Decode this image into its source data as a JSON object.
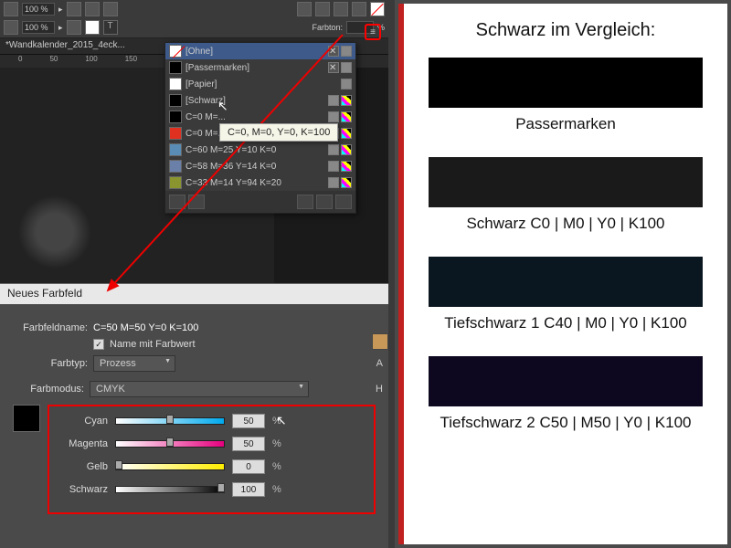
{
  "toolbar": {
    "pct1": "100 %",
    "pct2": "100 %",
    "farbton_label": "Farbton:",
    "farbton_unit": "%"
  },
  "document": {
    "tab": "*Wandkalender_2015_4eck...",
    "ruler_marks": [
      "0",
      "50",
      "100",
      "150"
    ]
  },
  "swatches": {
    "items": [
      {
        "name": "[Ohne]",
        "color": "transparent",
        "selected": true,
        "deletable": true
      },
      {
        "name": "[Passermarken]",
        "color": "#000",
        "deletable": true
      },
      {
        "name": "[Papier]",
        "color": "#fff"
      },
      {
        "name": "[Schwarz]",
        "color": "#000"
      },
      {
        "name": "C=0 M=...",
        "color": "#000"
      },
      {
        "name": "C=0 M=...",
        "color": "#e03020"
      },
      {
        "name": "C=60 M=25 Y=10 K=0",
        "color": "#5a8db5"
      },
      {
        "name": "C=58 M=36 Y=14 K=0",
        "color": "#6a80a8"
      },
      {
        "name": "C=33 M=14 Y=94 K=20",
        "color": "#8a9530"
      }
    ],
    "tooltip": "C=0, M=0, Y=0, K=100"
  },
  "dialog": {
    "title": "Neues Farbfeld",
    "name_label": "Farbfeldname:",
    "name_value": "C=50 M=50 Y=0 K=100",
    "name_with_value_label": "Name mit Farbwert",
    "farbtyp_label": "Farbtyp:",
    "farbtyp_value": "Prozess",
    "farbmodus_label": "Farbmodus:",
    "farbmodus_value": "CMYK",
    "buttons": {
      "a": "A",
      "h": "H"
    },
    "sliders": [
      {
        "label": "Cyan",
        "value": "50",
        "grad": "linear-gradient(90deg,#fff,#00aaee)",
        "pos": 50
      },
      {
        "label": "Magenta",
        "value": "50",
        "grad": "linear-gradient(90deg,#fff,#e6007e)",
        "pos": 50
      },
      {
        "label": "Gelb",
        "value": "0",
        "grad": "linear-gradient(90deg,#fff,#ffed00)",
        "pos": 0
      },
      {
        "label": "Schwarz",
        "value": "100",
        "grad": "linear-gradient(90deg,#fff,#000)",
        "pos": 100
      }
    ]
  },
  "comparison": {
    "title": "Schwarz im Vergleich:",
    "items": [
      {
        "label": "Passermarken",
        "color": "#000000"
      },
      {
        "label": "Schwarz C0 | M0 | Y0 | K100",
        "color": "#1a1a1a"
      },
      {
        "label": "Tiefschwarz 1 C40 | M0 | Y0 | K100",
        "color": "#0a1620"
      },
      {
        "label": "Tiefschwarz 2 C50 | M50 | Y0 | K100",
        "color": "#0d0820"
      }
    ]
  }
}
